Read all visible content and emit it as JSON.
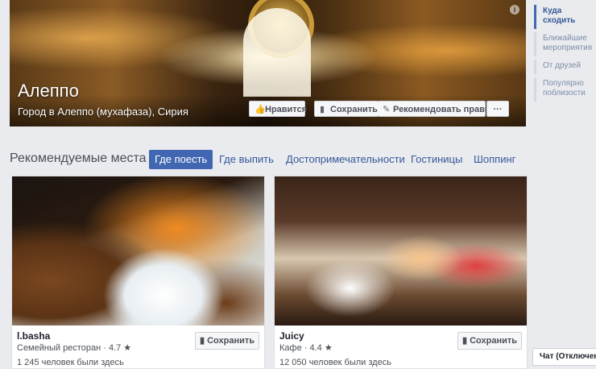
{
  "cover": {
    "title": "Алеппо",
    "subtitle": "Город в Алеппо (мухафаза), Сирия",
    "info_icon": "info-icon",
    "buttons": {
      "like": "Нравится",
      "save": "Сохранить",
      "recommend": "Рекомендовать правки",
      "more": "···"
    }
  },
  "sidebar": {
    "items": [
      {
        "label": "Куда сходить",
        "active": true
      },
      {
        "label": "Ближайшие мероприятия",
        "active": false
      },
      {
        "label": "От друзей",
        "active": false
      },
      {
        "label": "Популярно поблизости",
        "active": false
      }
    ]
  },
  "section": {
    "title": "Рекомендуемые места",
    "tabs": [
      {
        "label": "Где поесть",
        "active": true
      },
      {
        "label": "Где выпить",
        "active": false
      },
      {
        "label": "Достопримечательности",
        "active": false
      },
      {
        "label": "Гостиницы",
        "active": false
      },
      {
        "label": "Шоппинг",
        "active": false
      }
    ]
  },
  "cards": [
    {
      "name": "l.basha",
      "category": "Семейный ресторан",
      "rating": "4.7 ★",
      "visits": "1 245 человек были здесь",
      "save_label": "Сохранить"
    },
    {
      "name": "Juicy",
      "category": "Кафе",
      "rating": "4.4 ★",
      "visits": "12 050 человек были здесь",
      "save_label": "Сохранить"
    }
  ],
  "chat": {
    "label": "Чат (Отключен)"
  },
  "colors": {
    "accent": "#4267b2",
    "link": "#365899",
    "background": "#e9ebee"
  }
}
